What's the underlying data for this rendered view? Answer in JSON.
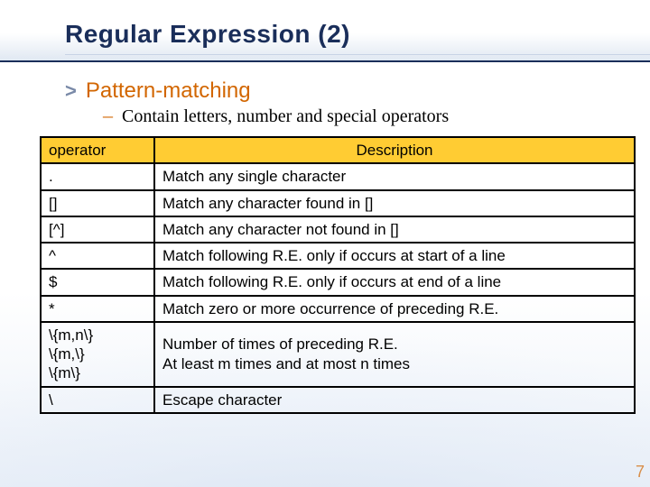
{
  "title": "Regular Expression (2)",
  "bullets": {
    "l1": "Pattern-matching",
    "l2": "Contain letters, number and special operators"
  },
  "table": {
    "headers": {
      "op": "operator",
      "desc": "Description"
    },
    "rows": [
      {
        "op": ".",
        "desc": "Match any single character"
      },
      {
        "op": "[]",
        "desc": "Match any character found in []"
      },
      {
        "op": "[^]",
        "desc": "Match any character not found in []"
      },
      {
        "op": "^",
        "desc": "Match following R.E. only if occurs at start of a line"
      },
      {
        "op": "$",
        "desc": "Match following R.E. only if occurs at end of a line"
      },
      {
        "op": "*",
        "desc": "Match zero or more occurrence of preceding R.E."
      },
      {
        "op": "\\{m,n\\}\n\\{m,\\}\n\\{m\\}",
        "desc": "Number of times of preceding R.E.\nAt least m times and at most n times"
      },
      {
        "op": "\\",
        "desc": "Escape character"
      }
    ]
  },
  "page_number": "7"
}
